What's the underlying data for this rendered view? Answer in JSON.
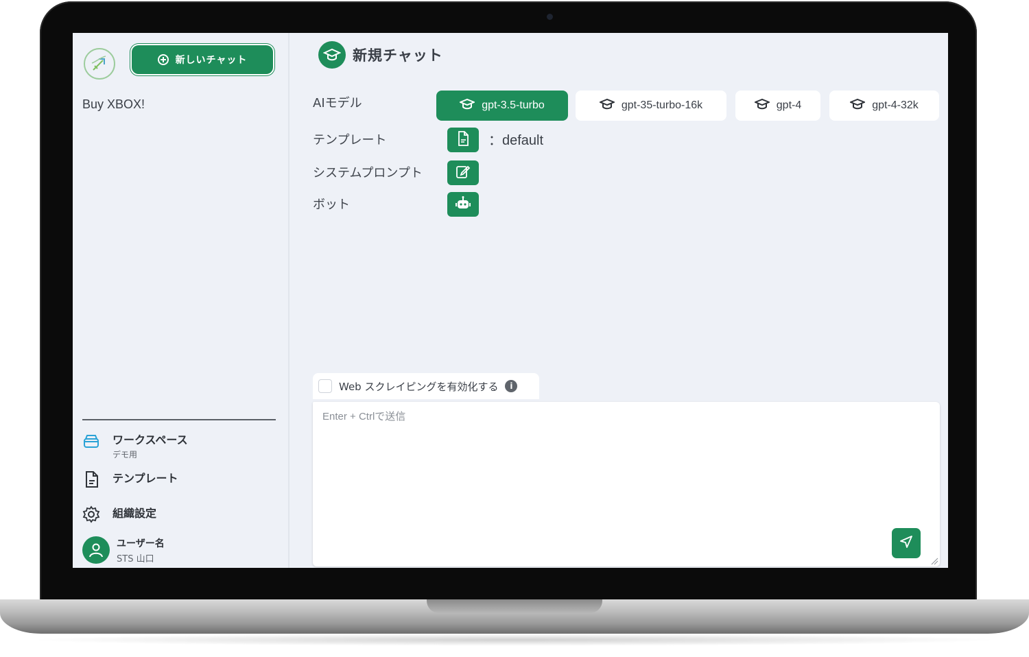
{
  "colors": {
    "accent": "#1e8d5a",
    "background": "#eef1f7",
    "frame": "#0b0b0b"
  },
  "sidebar": {
    "logo_icon": "rocket-logo-icon",
    "new_chat_label": "新しいチャット",
    "history": [
      {
        "label": "Buy XBOX!"
      }
    ],
    "nav": {
      "workspace": {
        "label": "ワークスペース",
        "sub": "デモ用",
        "icon": "workspace-stack-icon"
      },
      "template": {
        "label": "テンプレート",
        "icon": "document-icon"
      },
      "settings": {
        "label": "組織設定",
        "icon": "gear-icon"
      },
      "user": {
        "label": "ユーザー名",
        "sub": "STS 山口",
        "icon": "user-avatar-icon"
      }
    }
  },
  "main": {
    "title": "新規チャット",
    "title_icon": "graduation-cap-icon",
    "labels": {
      "ai_model": "AIモデル",
      "template": "テンプレート",
      "system_prompt": "システムプロンプト",
      "bot": "ボット"
    },
    "models": [
      {
        "label": "gpt-3.5-turbo",
        "active": true
      },
      {
        "label": "gpt-35-turbo-16k",
        "active": false
      },
      {
        "label": "gpt-4",
        "active": false
      },
      {
        "label": "gpt-4-32k",
        "active": false
      }
    ],
    "template_value": "：default",
    "web_scraping_label": "Web スクレイピングを有効化する",
    "web_scraping_checked": false,
    "input_placeholder": "Enter + Ctrlで送信",
    "input_value": ""
  }
}
